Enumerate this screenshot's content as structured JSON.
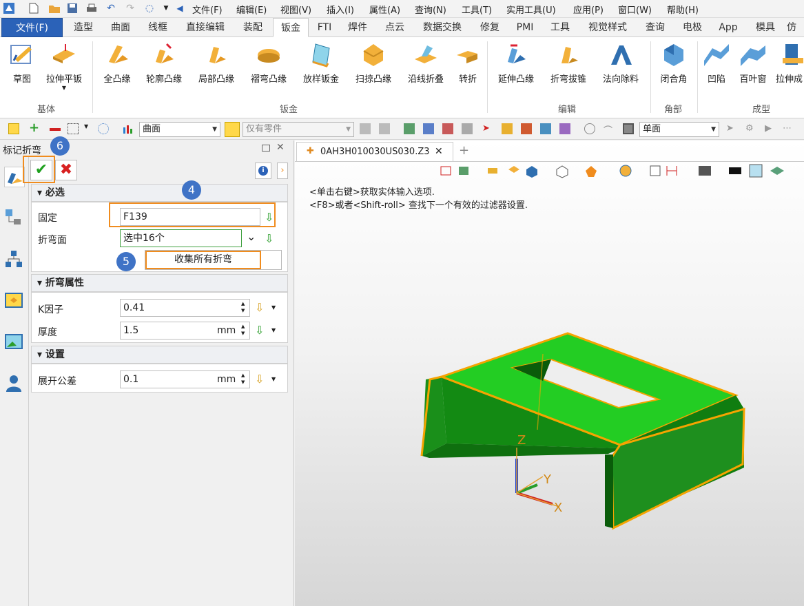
{
  "menubar": {
    "items": [
      "文件(F)",
      "编辑(E)",
      "视图(V)",
      "插入(I)",
      "属性(A)",
      "查询(N)",
      "工具(T)",
      "实用工具(U)",
      "应用(P)",
      "窗口(W)",
      "帮助(H)"
    ]
  },
  "ribbon_tabs": [
    "文件(F)",
    "造型",
    "曲面",
    "线框",
    "直接编辑",
    "装配",
    "钣金",
    "FTI",
    "焊件",
    "点云",
    "数据交换",
    "修复",
    "PMI",
    "工具",
    "视觉样式",
    "查询",
    "电极",
    "App",
    "模具",
    "仿"
  ],
  "ribbon": {
    "buttons": [
      "草图",
      "拉伸平钣",
      "全凸缘",
      "轮廓凸缘",
      "局部凸缘",
      "褶弯凸缘",
      "放样钣金",
      "扫掠凸缘",
      "沿线折叠",
      "转折",
      "延伸凸缘",
      "折弯拔锥",
      "法向除料",
      "闭合角",
      "凹陷",
      "百叶窗",
      "拉伸成"
    ],
    "groups": [
      "基体",
      "钣金",
      "编辑",
      "角部",
      "成型"
    ]
  },
  "toolbar": {
    "filter_combo": "曲面",
    "part_combo": "仅有零件",
    "face_combo": "单面"
  },
  "panel": {
    "title": "标记折弯",
    "sections": {
      "required": "必选",
      "bend_props": "折弯属性",
      "settings": "设置"
    },
    "fields": {
      "fixed_label": "固定",
      "fixed_value": "F139",
      "bend_face_label": "折弯面",
      "bend_face_value": "选中16个",
      "collect_button": "收集所有折弯",
      "k_label": "K因子",
      "k_value": "0.41",
      "thickness_label": "厚度",
      "thickness_value": "1.5",
      "thickness_unit": "mm",
      "tolerance_label": "展开公差",
      "tolerance_value": "0.1",
      "tolerance_unit": "mm"
    },
    "badges": [
      "6",
      "4",
      "5"
    ]
  },
  "document_tab": {
    "name": "0AH3H010030US030.Z3"
  },
  "viewport": {
    "hints": [
      "<单击右键>获取实体输入选项.",
      "<F8>或者<Shift-roll> 查找下一个有效的过滤器设置."
    ],
    "axes": {
      "x": "X",
      "y": "Y",
      "z": "Z"
    }
  },
  "colors": {
    "accent": "#2b62b8",
    "highlight": "#f08c1e",
    "part_green": "#19c419",
    "edge_orange": "#f5a400"
  }
}
